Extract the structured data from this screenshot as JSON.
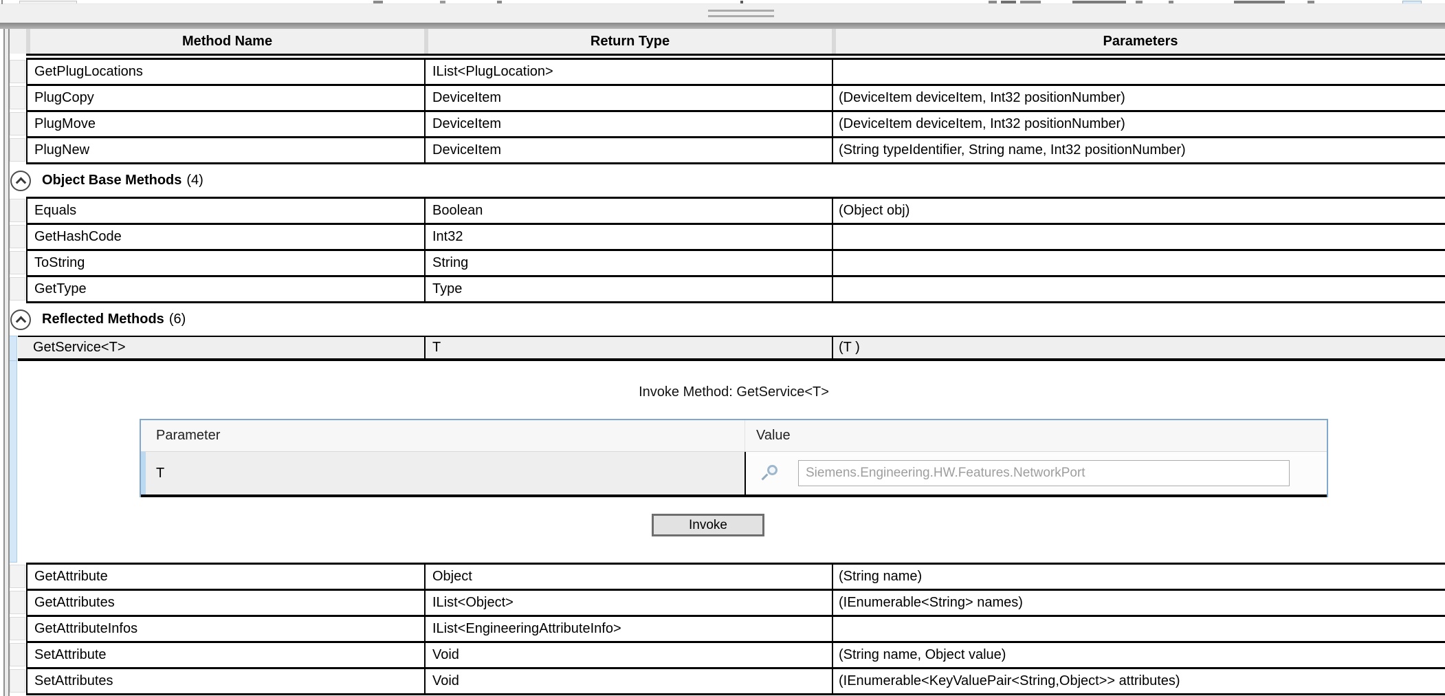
{
  "colors": {
    "selection_blue": "#d3e7f8",
    "panel_border_blue": "#7fa8cc",
    "header_bg": "#f0f0f0",
    "row_border": "#000000"
  },
  "header": {
    "method_name": "Method Name",
    "return_type": "Return Type",
    "parameters": "Parameters"
  },
  "methods_top": [
    {
      "name": "GetPlugLocations",
      "return_type": "IList<PlugLocation>",
      "parameters": ""
    },
    {
      "name": "PlugCopy",
      "return_type": "DeviceItem",
      "parameters": "(DeviceItem deviceItem, Int32 positionNumber)"
    },
    {
      "name": "PlugMove",
      "return_type": "DeviceItem",
      "parameters": "(DeviceItem deviceItem, Int32 positionNumber)"
    },
    {
      "name": "PlugNew",
      "return_type": "DeviceItem",
      "parameters": "(String typeIdentifier, String name, Int32 positionNumber)"
    }
  ],
  "section_object_base": {
    "title": "Object Base Methods",
    "count": "(4)"
  },
  "methods_object_base": [
    {
      "name": "Equals",
      "return_type": "Boolean",
      "parameters": "(Object obj)"
    },
    {
      "name": "GetHashCode",
      "return_type": "Int32",
      "parameters": ""
    },
    {
      "name": "ToString",
      "return_type": "String",
      "parameters": ""
    },
    {
      "name": "GetType",
      "return_type": "Type",
      "parameters": ""
    }
  ],
  "section_reflected": {
    "title": "Reflected Methods",
    "count": "(6)"
  },
  "selected_method": {
    "name": "GetService<T>",
    "return_type": "T",
    "parameters": "(T )"
  },
  "invoke_panel": {
    "title": "Invoke Method: GetService<T>",
    "table": {
      "param_header": "Parameter",
      "value_header": "Value",
      "rows": [
        {
          "parameter": "T",
          "value_placeholder": "Siemens.Engineering.HW.Features.NetworkPort"
        }
      ]
    },
    "invoke_button": "Invoke"
  },
  "methods_bottom": [
    {
      "name": "GetAttribute",
      "return_type": "Object",
      "parameters": "(String name)"
    },
    {
      "name": "GetAttributes",
      "return_type": "IList<Object>",
      "parameters": "(IEnumerable<String> names)"
    },
    {
      "name": "GetAttributeInfos",
      "return_type": "IList<EngineeringAttributeInfo>",
      "parameters": ""
    },
    {
      "name": "SetAttribute",
      "return_type": "Void",
      "parameters": "(String name, Object value)"
    },
    {
      "name": "SetAttributes",
      "return_type": "Void",
      "parameters": "(IEnumerable<KeyValuePair<String,Object>> attributes)"
    }
  ]
}
